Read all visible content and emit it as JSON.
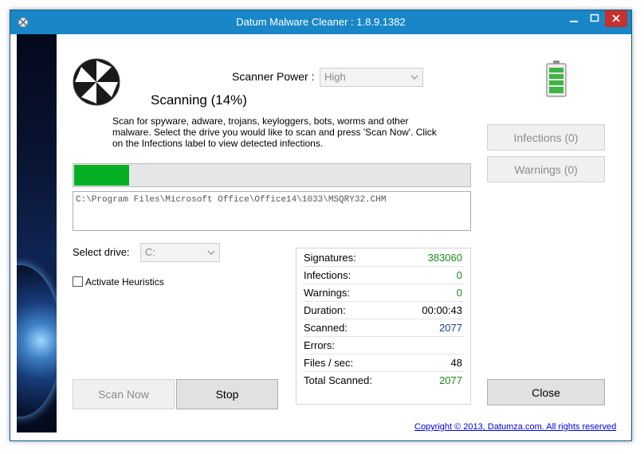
{
  "window": {
    "title": "Datum Malware Cleaner : 1.8.9.1382"
  },
  "scanner": {
    "status": "Scanning (14%)",
    "progress_percent": 14,
    "power_label": "Scanner Power :",
    "power_value": "High",
    "description": "Scan for spyware, adware, trojans, keyloggers, bots, worms and other malware. Select the drive you would like to scan and press 'Scan Now'. Click on the Infections label to view detected infections.",
    "current_file": "C:\\Program Files\\Microsoft Office\\Office14\\1033\\MSQRY32.CHM",
    "drive_label": "Select drive:",
    "drive_value": "C:",
    "heuristics_label": "Activate Heuristics",
    "heuristics_checked": false
  },
  "stats": [
    {
      "label": "Signatures:",
      "value": "383060",
      "color": "#1a8a1a"
    },
    {
      "label": "Infections:",
      "value": "0",
      "color": "#1a8a1a"
    },
    {
      "label": "Warnings:",
      "value": "0",
      "color": "#1a8a1a"
    },
    {
      "label": "Duration:",
      "value": "00:00:43",
      "color": "#000000"
    },
    {
      "label": "Scanned:",
      "value": "2077",
      "color": "#1a3fa8"
    },
    {
      "label": "Errors:",
      "value": "",
      "color": "#000000"
    },
    {
      "label": "Files / sec:",
      "value": "48",
      "color": "#000000"
    },
    {
      "label": "Total Scanned:",
      "value": "2077",
      "color": "#1a8a1a"
    }
  ],
  "buttons": {
    "scan_now": "Scan Now",
    "stop": "Stop",
    "close": "Close",
    "infections": "Infections (0)",
    "warnings": "Warnings (0)"
  },
  "footer": {
    "copyright": "Copyright © 2013, Datumza.com. All rights reserved"
  },
  "colors": {
    "titlebar": "#1987c7",
    "progress_fill": "#06b025",
    "close_control": "#c7302b"
  },
  "icons": [
    "app-icon",
    "minimize-icon",
    "maximize-icon",
    "close-icon",
    "umbrella-logo-icon",
    "chevron-down-icon",
    "battery-icon"
  ]
}
